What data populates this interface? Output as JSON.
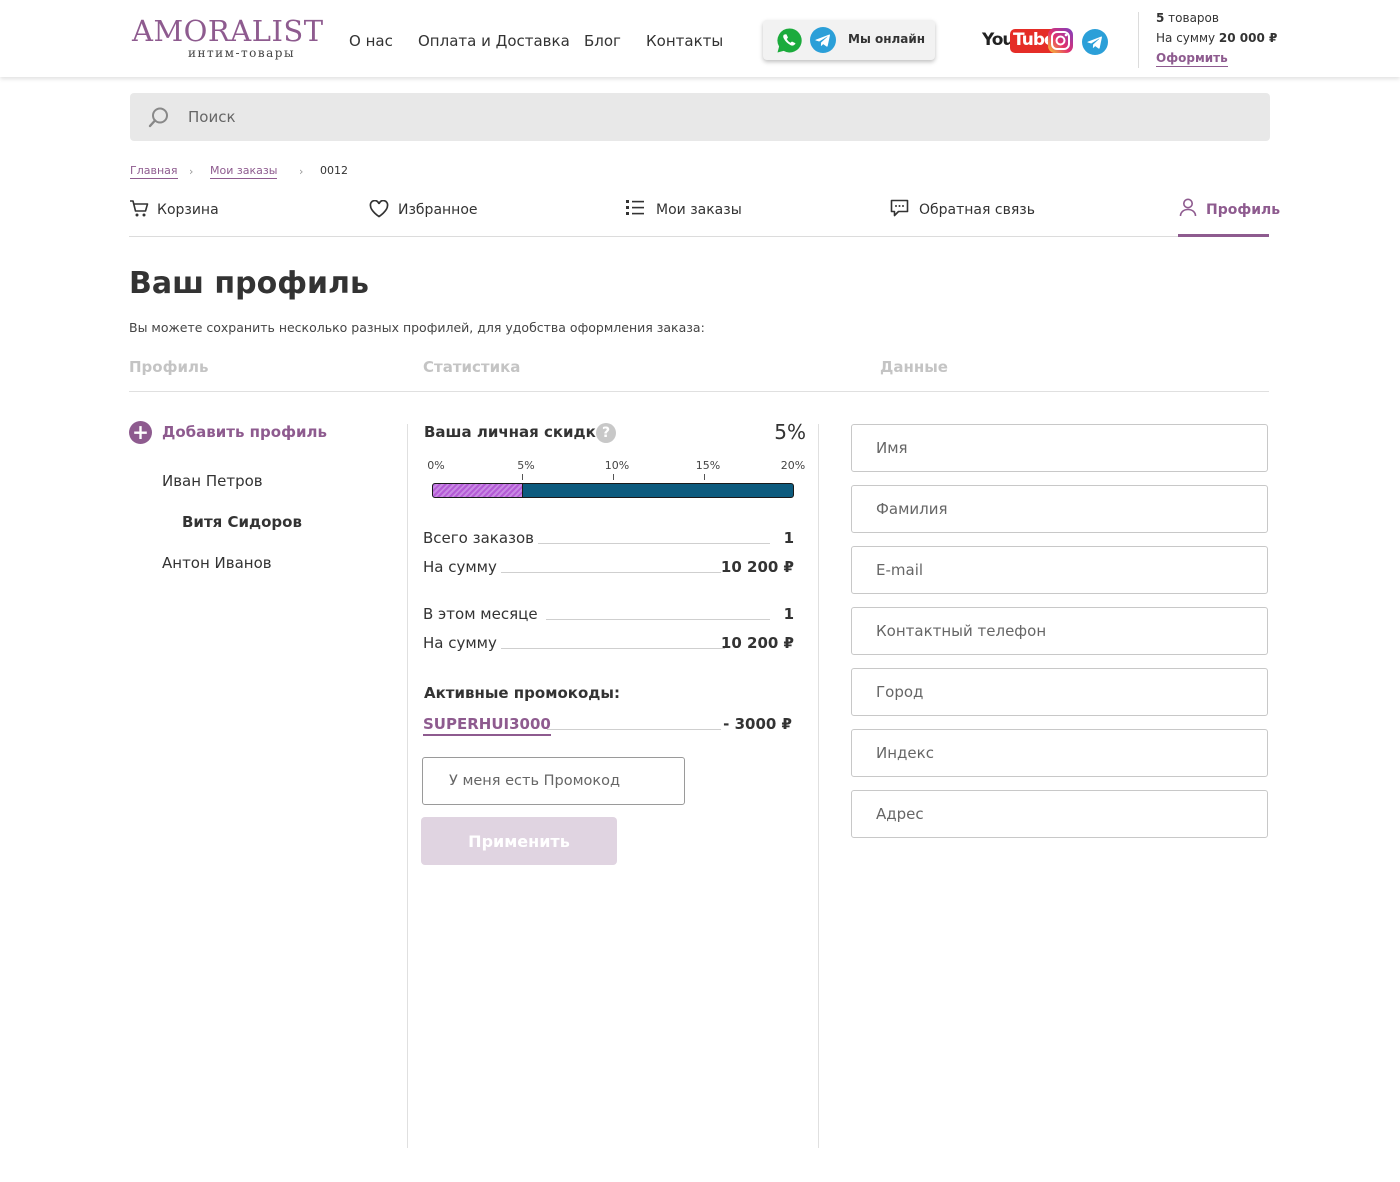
{
  "header": {
    "logo_main": "AMORALIST",
    "logo_sub": "интим-товары",
    "nav": [
      "О нас",
      "Оплата и Доставка",
      "Блог",
      "Контакты"
    ],
    "online_label": "Мы онлайн",
    "messengers": [
      "whatsapp-icon",
      "telegram-icon"
    ],
    "socials": [
      "youtube-icon",
      "instagram-icon",
      "telegram-icon"
    ],
    "youtube_text_a": "You",
    "youtube_text_b": "Tube",
    "cart": {
      "count": "5",
      "count_label": " товаров",
      "sum_label": "На сумму ",
      "sum": "20 000 ₽",
      "checkout_label": "Оформить"
    }
  },
  "search": {
    "placeholder": "Поиск"
  },
  "breadcrumb": {
    "home": "Главная",
    "orders": "Мои заказы",
    "current": "0012",
    "sep": "›"
  },
  "tabs": [
    {
      "label": "Корзина",
      "icon": "cart-icon"
    },
    {
      "label": "Избранное",
      "icon": "heart-icon"
    },
    {
      "label": "Мои заказы",
      "icon": "list-icon"
    },
    {
      "label": "Обратная связь",
      "icon": "chat-icon"
    },
    {
      "label": "Профиль",
      "icon": "user-icon",
      "active": true
    }
  ],
  "page": {
    "title": "Ваш профиль",
    "description": "Вы можете сохранить несколько разных профилей, для удобства оформления заказа:",
    "columns": [
      "Профиль",
      "Статистика",
      "Данные"
    ]
  },
  "profiles": {
    "add_label": "Добавить профиль",
    "add_icon": "+",
    "items": [
      "Иван Петров",
      "Витя Сидоров",
      "Антон Иванов"
    ],
    "selected_index": 1
  },
  "stats": {
    "discount_label": "Ваша личная скидка:",
    "help_icon": "?",
    "discount_value": "5%",
    "discount_level": 0.25,
    "scale_ticks": [
      "0%",
      "5%",
      "10%",
      "15%",
      "20%"
    ],
    "total_orders_label": "Всего заказов",
    "total_orders": "1",
    "total_sum_label": "На сумму",
    "total_sum": "10 200 ₽",
    "month_orders_label": "В этом месяце",
    "month_orders": "1",
    "month_sum_label": "На сумму",
    "month_sum": "10 200 ₽",
    "promo_title": "Активные промокоды:",
    "promo_code": "SUPERHUI3000",
    "promo_value": "- 3000 ₽",
    "promo_placeholder": "У меня есть Промокод",
    "apply_label": "Применить"
  },
  "form": {
    "placeholders": [
      "Имя",
      "Фамилия",
      "E-mail",
      "Контактный телефон",
      "Город",
      "Индекс",
      "Адрес"
    ]
  },
  "colors": {
    "accent": "#8e5b8f",
    "bar": "#0d5b7e",
    "bar_fill": "#b45bd6"
  }
}
